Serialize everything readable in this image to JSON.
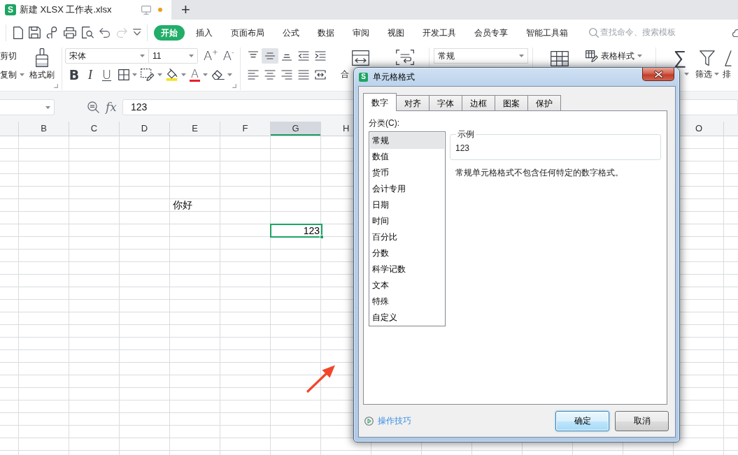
{
  "title_bar": {
    "logo": "S",
    "document": "新建 XLSX 工作表.xlsx",
    "unsaved": true,
    "new_tab": "+"
  },
  "menu_bar": {
    "redo_disabled": true,
    "tabs": [
      {
        "label": "开始",
        "selected": true
      },
      {
        "label": "插入",
        "selected": false
      },
      {
        "label": "页面布局",
        "selected": false
      },
      {
        "label": "公式",
        "selected": false
      },
      {
        "label": "数据",
        "selected": false
      },
      {
        "label": "审阅",
        "selected": false
      },
      {
        "label": "视图",
        "selected": false
      },
      {
        "label": "开发工具",
        "selected": false
      },
      {
        "label": "会员专享",
        "selected": false
      },
      {
        "label": "智能工具箱",
        "selected": false
      }
    ],
    "search": {
      "placeholder": "查找命令、搜索模板"
    }
  },
  "ribbon": {
    "cut": "剪切",
    "copy": "复制",
    "format_painter": "格式刷",
    "font_name": "宋体",
    "font_size": "11",
    "grow_font": "A$^{+}$",
    "shrink_font": "A$^{-}$",
    "format_buttons": [
      {
        "kind": "bold",
        "glyph": "B"
      },
      {
        "kind": "italic",
        "glyph": "I"
      },
      {
        "kind": "underline",
        "glyph": "U"
      },
      {
        "kind": "borders"
      },
      {
        "kind": "cell_style"
      },
      {
        "kind": "fill"
      },
      {
        "kind": "font_color",
        "glyph": "A"
      },
      {
        "kind": "clear"
      }
    ],
    "vertical_align": [
      {
        "selected": false
      },
      {
        "selected": true
      },
      {
        "selected": false
      }
    ],
    "merge": "合",
    "number_format": "常规",
    "table_style": "表格样式",
    "sum": "∑",
    "filter": "筛选",
    "sort": "排"
  },
  "formula_bar": {
    "fx": "fx",
    "formula": "123"
  },
  "sheet": {
    "columns": [
      {
        "label": "B",
        "selected": false
      },
      {
        "label": "C",
        "selected": false
      },
      {
        "label": "D",
        "selected": false
      },
      {
        "label": "E",
        "selected": false
      },
      {
        "label": "F",
        "selected": false
      },
      {
        "label": "G",
        "selected": true
      },
      {
        "label": "H",
        "selected": false
      },
      {
        "label": "O",
        "selected": false
      }
    ],
    "cells": [
      {
        "text": "你好",
        "selected": false
      },
      {
        "text": "123",
        "selected": true
      }
    ]
  },
  "annotations": [
    {
      "kind": "arrow"
    }
  ],
  "dialog": {
    "logo": "S",
    "title": "单元格格式",
    "tabs": [
      {
        "label": "数字",
        "selected": true
      },
      {
        "label": "对齐",
        "selected": false
      },
      {
        "label": "字体",
        "selected": false
      },
      {
        "label": "边框",
        "selected": false
      },
      {
        "label": "图案",
        "selected": false
      },
      {
        "label": "保护",
        "selected": false
      }
    ],
    "category_label": "分类(C):",
    "categories": [
      {
        "label": "常规",
        "selected": true
      },
      {
        "label": "数值",
        "selected": false
      },
      {
        "label": "货币",
        "selected": false
      },
      {
        "label": "会计专用",
        "selected": false
      },
      {
        "label": "日期",
        "selected": false
      },
      {
        "label": "时间",
        "selected": false
      },
      {
        "label": "百分比",
        "selected": false
      },
      {
        "label": "分数",
        "selected": false
      },
      {
        "label": "科学记数",
        "selected": false
      },
      {
        "label": "文本",
        "selected": false
      },
      {
        "label": "特殊",
        "selected": false
      },
      {
        "label": "自定义",
        "selected": false
      }
    ],
    "sample": {
      "label": "示例",
      "value": "123"
    },
    "description": "常规单元格格式不包含任何特定的数字格式。",
    "tips": "操作技巧",
    "buttons": [
      {
        "label": "确定",
        "focused": true
      },
      {
        "label": "取消",
        "focused": false
      }
    ]
  }
}
